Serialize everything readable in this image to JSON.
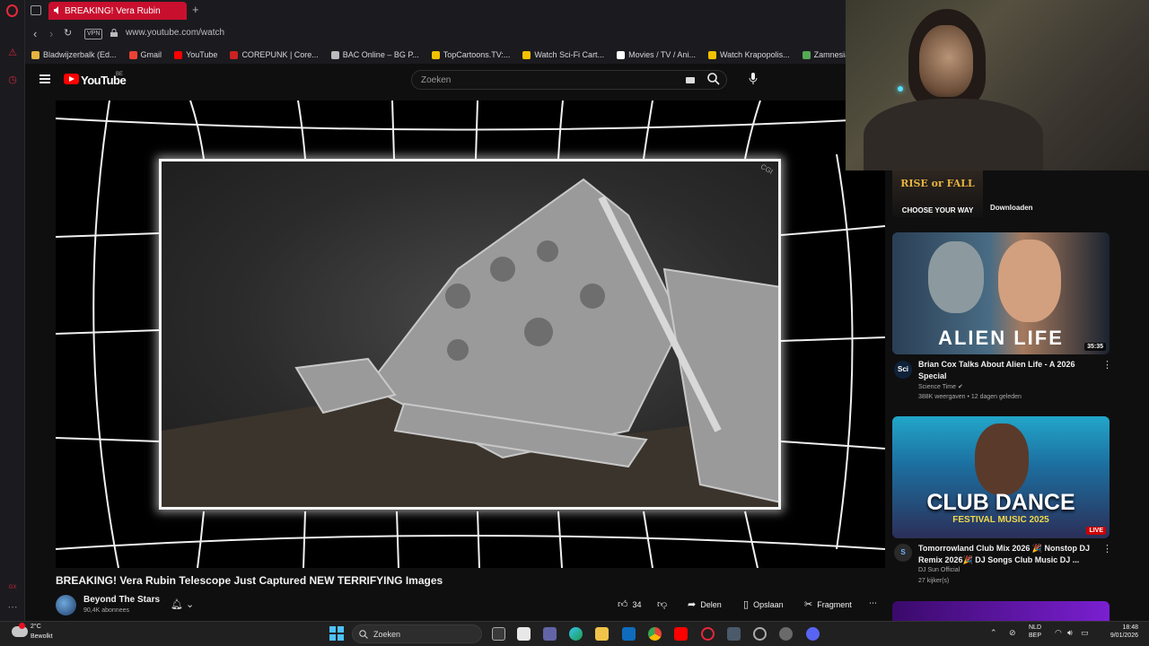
{
  "browser": {
    "tab_title": "BREAKING! Vera Rubin",
    "new_tab": "+",
    "vpn_label": "VPN",
    "url": "www.youtube.com/watch",
    "bookmarks": [
      {
        "label": "Bladwijzerbalk (Ed...",
        "color": "#e6b340"
      },
      {
        "label": "Gmail",
        "color": "#ea4335"
      },
      {
        "label": "YouTube",
        "color": "#ff0000"
      },
      {
        "label": "COREPUNK | Core...",
        "color": "#cc2222"
      },
      {
        "label": "BAC Online – BG P...",
        "color": "#bbbbbb"
      },
      {
        "label": "TopCartoons.TV:...",
        "color": "#f2c200"
      },
      {
        "label": "Watch Sci-Fi Cart...",
        "color": "#f2c200"
      },
      {
        "label": "Movies / TV / Ani...",
        "color": "#ffffff"
      },
      {
        "label": "Watch Krapopolis...",
        "color": "#f2c200"
      },
      {
        "label": "Zamnesia | Het Be",
        "color": "#55aa55"
      }
    ]
  },
  "youtube": {
    "logo_text": "YouTube",
    "region": "BE",
    "search_placeholder": "Zoeken"
  },
  "video": {
    "watermark": "CGI",
    "title": "BREAKING! Vera Rubin Telescope Just Captured NEW TERRIFYING Images",
    "channel": "Beyond The Stars",
    "subscribers": "90,4K abonnees",
    "likes": "34",
    "share": "Delen",
    "save": "Opslaan",
    "clip": "Fragment",
    "more": "⋯"
  },
  "sidebar": {
    "ad": {
      "title": "RISE or FALL",
      "subtitle": "CHOOSE YOUR WAY",
      "button": "Downloaden"
    },
    "videos": [
      {
        "thumb_text": "ALIEN LIFE",
        "badge": "35:35",
        "title": "Brian Cox Talks About Alien Life - A 2026 Special",
        "channel": "Science Time",
        "meta": "388K weergaven • 12 dagen geleden",
        "avatar_text": "Sci"
      },
      {
        "thumb_text": "CLUB DANCE",
        "thumb_sub": "FESTIVAL MUSIC 2025",
        "badge": "LIVE",
        "title": "Tomorrowland Club Mix 2026 🎉 Nonstop DJ Remix 2026🎉 DJ Songs Club Music DJ ...",
        "channel": "DJ Sun Official",
        "meta": "27 kijker(s)",
        "avatar_text": "S"
      }
    ]
  },
  "taskbar": {
    "temp": "2°C",
    "condition": "Bewolkt",
    "search_placeholder": "Zoeken",
    "lang_top": "NLD",
    "lang_bottom": "BEP",
    "time": "18:48",
    "date": "9/01/2026"
  },
  "colors": {
    "accent": "#c8102e",
    "yt_red": "#ff0000"
  }
}
